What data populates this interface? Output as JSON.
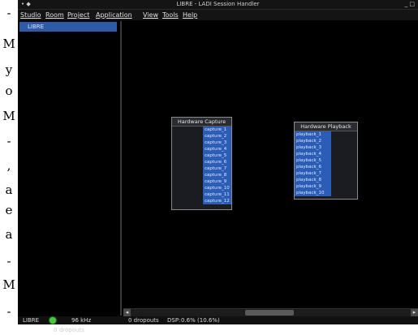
{
  "page_edge_text": [
    "-",
    "M",
    "y",
    "o",
    "M",
    "-",
    ",",
    "a",
    "e",
    "a",
    "-",
    "M",
    "-"
  ],
  "window": {
    "title": "LIBRE - LADI Session Handler",
    "left_controls": "•  ◆",
    "right_controls": "_ □"
  },
  "menu": [
    "Studio",
    "Room",
    "Project",
    "Application",
    "View",
    "Tools",
    "Help"
  ],
  "studio_list": {
    "selected": "LIBRE"
  },
  "left_panel": {
    "dropouts": "0 dropouts"
  },
  "modules": {
    "capture": {
      "title": "Hardware Capture",
      "ports": [
        "capture_1",
        "capture_2",
        "capture_3",
        "capture_4",
        "capture_5",
        "capture_6",
        "capture_7",
        "capture_8",
        "capture_9",
        "capture_10",
        "capture_11",
        "capture_12"
      ]
    },
    "playback": {
      "title": "Hardware Playback",
      "ports": [
        "playback_1",
        "playback_2",
        "playback_3",
        "playback_4",
        "playback_5",
        "playback_6",
        "playback_7",
        "playback_8",
        "playback_9",
        "playback_10"
      ]
    }
  },
  "scrollbar": {
    "left_arrow": "◂",
    "right_arrow": "▸"
  },
  "status": {
    "studio": "LIBRE",
    "sample_rate": "96 kHz",
    "dropouts": "0 dropouts",
    "dsp_label": "DSP:",
    "dsp_value": "0.6% (10.6%)",
    "led_color": "#44c83a"
  }
}
